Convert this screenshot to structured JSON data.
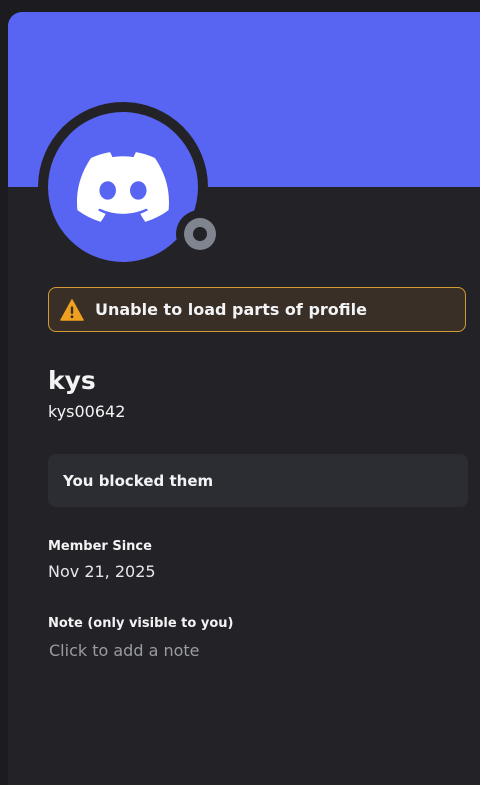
{
  "profile": {
    "display_name": "kys",
    "username": "kys00642",
    "status": "offline"
  },
  "warning": {
    "text": "Unable to load parts of profile",
    "icon": "warning-triangle-icon"
  },
  "relationship": {
    "text": "You blocked them"
  },
  "member_since": {
    "label": "Member Since",
    "value": "Nov 21, 2025"
  },
  "note": {
    "label": "Note (only visible to you)",
    "placeholder": "Click to add a note"
  },
  "colors": {
    "banner": "#5865f2",
    "panel_background": "#232327",
    "warning_border": "#d29b35",
    "warning_icon": "#f0a020",
    "status_offline": "#80848e"
  }
}
